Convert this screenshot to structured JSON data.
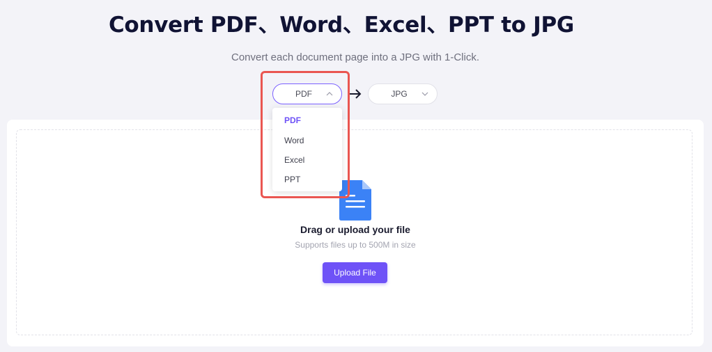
{
  "header": {
    "title": "Convert PDF、Word、Excel、PPT to JPG",
    "subtitle": "Convert each document page into a JPG with 1-Click."
  },
  "converter": {
    "from_value": "PDF",
    "to_value": "JPG",
    "from_options": [
      "PDF",
      "Word",
      "Excel",
      "PPT"
    ],
    "selected_option": "PDF"
  },
  "upload": {
    "drag_text": "Drag or upload your file",
    "size_note": "Supports files up to 500M in size",
    "button_label": "Upload File"
  },
  "colors": {
    "accent": "#6e52f7",
    "highlight": "#ea5651",
    "doc_icon": "#3b82f6",
    "title": "#101334"
  },
  "icons": {
    "from_chevron": "chevron-up-icon",
    "to_chevron": "chevron-down-icon",
    "separator": "arrow-right-icon",
    "file": "document-icon"
  }
}
